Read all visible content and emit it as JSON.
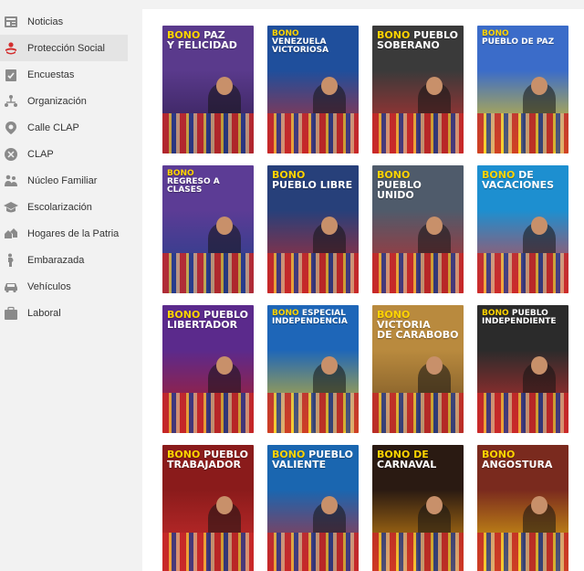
{
  "sidebar": {
    "items": [
      {
        "label": "Noticias",
        "icon": "news-icon",
        "active": false
      },
      {
        "label": "Protección Social",
        "icon": "social-protection-icon",
        "active": true
      },
      {
        "label": "Encuestas",
        "icon": "survey-icon",
        "active": false
      },
      {
        "label": "Organización",
        "icon": "organization-icon",
        "active": false
      },
      {
        "label": "Calle CLAP",
        "icon": "street-clap-icon",
        "active": false
      },
      {
        "label": "CLAP",
        "icon": "clap-icon",
        "active": false
      },
      {
        "label": "Núcleo Familiar",
        "icon": "family-icon",
        "active": false
      },
      {
        "label": "Escolarización",
        "icon": "school-icon",
        "active": false
      },
      {
        "label": "Hogares de la Patria",
        "icon": "homes-icon",
        "active": false
      },
      {
        "label": "Embarazada",
        "icon": "pregnant-icon",
        "active": false
      },
      {
        "label": "Vehículos",
        "icon": "vehicle-icon",
        "active": false
      },
      {
        "label": "Laboral",
        "icon": "briefcase-icon",
        "active": false
      }
    ]
  },
  "cards": [
    {
      "line1a": "BONO",
      "line1b": "PAZ",
      "line2": "Y FELICIDAD",
      "bg": "#5a3a8c",
      "accent": "#2b1a4a"
    },
    {
      "line1a": "BONO",
      "line1b": "",
      "line2": "VENEZUELA VICTORIOSA",
      "bg": "#1f4f9c",
      "accent": "#c62828"
    },
    {
      "line1a": "BONO",
      "line1b": "PUEBLO",
      "line2": "SOBERANO",
      "bg": "#3a3a3a",
      "accent": "#d32f2f"
    },
    {
      "line1a": "BONO",
      "line1b": "",
      "line2": "PUEBLO DE PAZ",
      "bg": "#3b6cc9",
      "accent": "#ffd400"
    },
    {
      "line1a": "BONO",
      "line1b": "",
      "line2": "REGRESO A CLASES",
      "bg": "#5c3c95",
      "accent": "#1e3f8a"
    },
    {
      "line1a": "BONO",
      "line1b": "",
      "line2": "PUEBLO LIBRE",
      "bg": "#27407a",
      "accent": "#c62828"
    },
    {
      "line1a": "BONO",
      "line1b": "",
      "line2": "PUEBLO UNIDO",
      "bg": "#4f5b6b",
      "accent": "#c62828"
    },
    {
      "line1a": "BONO",
      "line1b": "DE",
      "line2": "VACACIONES",
      "bg": "#1d8fd0",
      "accent": "#e53935"
    },
    {
      "line1a": "BONO",
      "line1b": "PUEBLO",
      "line2": "LIBERTADOR",
      "bg": "#5b2a8c",
      "accent": "#b71c1c"
    },
    {
      "line1a": "BONO",
      "line1b": "ESPECIAL",
      "line2": "INDEPENDENCIA",
      "bg": "#1e66b8",
      "accent": "#f1c40f"
    },
    {
      "line1a": "BONO",
      "line1b": "VICTORIA",
      "line2": "DE CARABOBO",
      "bg": "#b98a3e",
      "accent": "#6b4a1f"
    },
    {
      "line1a": "BONO",
      "line1b": "PUEBLO",
      "line2": "INDEPENDIENTE",
      "bg": "#2b2b2b",
      "accent": "#d32f2f"
    },
    {
      "line1a": "BONO",
      "line1b": "PUEBLO",
      "line2": "TRABAJADOR",
      "bg": "#8a1b1b",
      "accent": "#d32f2f"
    },
    {
      "line1a": "BONO",
      "line1b": "PUEBLO",
      "line2": "VALIENTE",
      "bg": "#1a66b0",
      "accent": "#c62828"
    },
    {
      "line1a": "BONO DE",
      "line1b": "",
      "line2": "CARNAVAL",
      "bg": "#2a1a12",
      "accent": "#f39c12"
    },
    {
      "line1a": "BONO",
      "line1b": "",
      "line2": "ANGOSTURA",
      "bg": "#7a2a1e",
      "accent": "#f1c40f"
    }
  ]
}
